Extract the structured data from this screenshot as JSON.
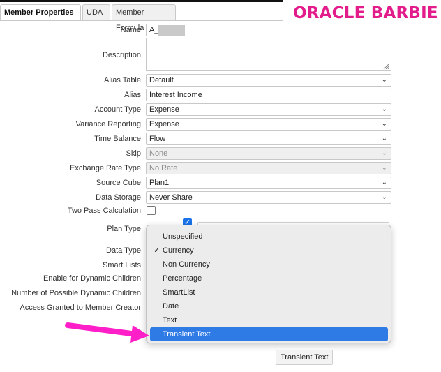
{
  "tabs": [
    {
      "label": "Member Properties",
      "active": true
    },
    {
      "label": "UDA",
      "active": false
    },
    {
      "label": "Member Formula",
      "active": false
    }
  ],
  "brand": {
    "text": "ORACLE BARBIE",
    "color": "#e31c8c"
  },
  "form": {
    "name": {
      "label": "Name",
      "value": "A_"
    },
    "description": {
      "label": "Description",
      "value": ""
    },
    "alias_table": {
      "label": "Alias Table",
      "value": "Default"
    },
    "alias": {
      "label": "Alias",
      "value": "Interest Income"
    },
    "account_type": {
      "label": "Account Type",
      "value": "Expense"
    },
    "variance_reporting": {
      "label": "Variance Reporting",
      "value": "Expense"
    },
    "time_balance": {
      "label": "Time Balance",
      "value": "Flow"
    },
    "skip": {
      "label": "Skip",
      "value": "None"
    },
    "exchange_rate_type": {
      "label": "Exchange Rate Type",
      "value": "No Rate"
    },
    "source_cube": {
      "label": "Source Cube",
      "value": "Plan1"
    },
    "data_storage": {
      "label": "Data Storage",
      "value": "Never Share"
    },
    "two_pass": {
      "label": "Two Pass Calculation",
      "checked": false
    },
    "plan_type": {
      "label": "Plan Type",
      "checked": true
    },
    "data_type": {
      "label": "Data Type"
    },
    "smart_lists": {
      "label": "Smart Lists"
    },
    "enable_dynamic_children": {
      "label": "Enable for Dynamic Children"
    },
    "num_dynamic_children": {
      "label": "Number of Possible Dynamic Children"
    },
    "access_granted": {
      "label": "Access Granted to Member Creator"
    }
  },
  "data_type_dropdown": {
    "options": [
      "Unspecified",
      "Currency",
      "Non Currency",
      "Percentage",
      "SmartList",
      "Date",
      "Text",
      "Transient Text"
    ],
    "checked": "Currency",
    "highlighted": "Transient Text"
  },
  "tooltip": {
    "text": "Transient Text"
  },
  "annotation": {
    "arrow_color": "#ff1fc8",
    "icon": "arrow-right-icon"
  },
  "colors": {
    "accent": "#2f7be6",
    "checkbox": "#1a73e8"
  }
}
